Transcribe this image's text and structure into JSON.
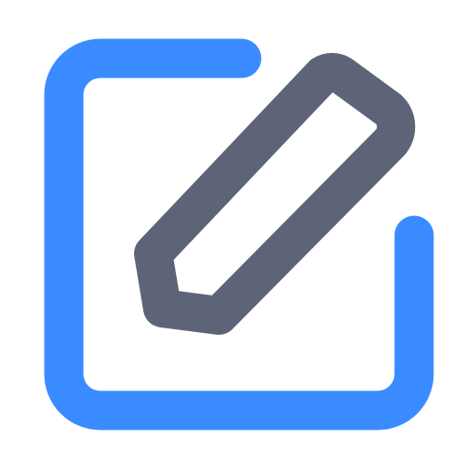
{
  "icon": {
    "name": "edit-icon",
    "parts": [
      {
        "name": "document-frame",
        "color": "#3A8BFF"
      },
      {
        "name": "pencil",
        "color": "#5E6478"
      }
    ]
  }
}
